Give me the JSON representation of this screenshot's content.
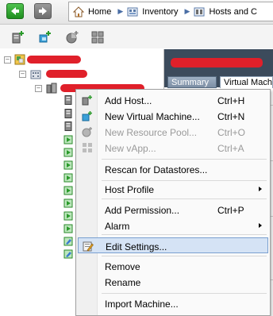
{
  "breadcrumb": {
    "items": [
      {
        "label": "Home",
        "icon": "home-icon"
      },
      {
        "label": "Inventory",
        "icon": "inventory-icon"
      },
      {
        "label": "Hosts and C",
        "icon": "hosts-clusters-icon"
      }
    ]
  },
  "toolbar": {
    "icons": [
      "add-host-icon",
      "new-vm-icon",
      "new-resource-pool-icon",
      "new-vapp-icon"
    ]
  },
  "right_pane": {
    "tabs": [
      {
        "label": "Summary"
      },
      {
        "label": "Virtual Machi"
      }
    ]
  },
  "context_menu": {
    "items": [
      {
        "label": "Add Host...",
        "shortcut": "Ctrl+H",
        "enabled": true,
        "icon": "add-host-icon"
      },
      {
        "label": "New Virtual Machine...",
        "shortcut": "Ctrl+N",
        "enabled": true,
        "icon": "new-vm-icon"
      },
      {
        "label": "New Resource Pool...",
        "shortcut": "Ctrl+O",
        "enabled": false,
        "icon": "resource-pool-icon"
      },
      {
        "label": "New vApp...",
        "shortcut": "Ctrl+A",
        "enabled": false,
        "icon": "vapp-icon"
      },
      {
        "label": "Rescan for Datastores...",
        "shortcut": "",
        "enabled": true
      },
      {
        "label": "Host Profile",
        "shortcut": "",
        "enabled": true,
        "submenu": true
      },
      {
        "label": "Add Permission...",
        "shortcut": "Ctrl+P",
        "enabled": true
      },
      {
        "label": "Alarm",
        "shortcut": "",
        "enabled": true,
        "submenu": true
      },
      {
        "label": "Edit Settings...",
        "shortcut": "",
        "enabled": true,
        "highlighted": true,
        "icon": "edit-settings-icon"
      },
      {
        "label": "Remove",
        "shortcut": "",
        "enabled": true
      },
      {
        "label": "Rename",
        "shortcut": "",
        "enabled": true
      },
      {
        "label": "Import Machine...",
        "shortcut": "",
        "enabled": true
      }
    ]
  },
  "colors": {
    "selection": "#d5e3f5",
    "redaction": "#e0202a",
    "header_dark": "#3c4b5c"
  }
}
